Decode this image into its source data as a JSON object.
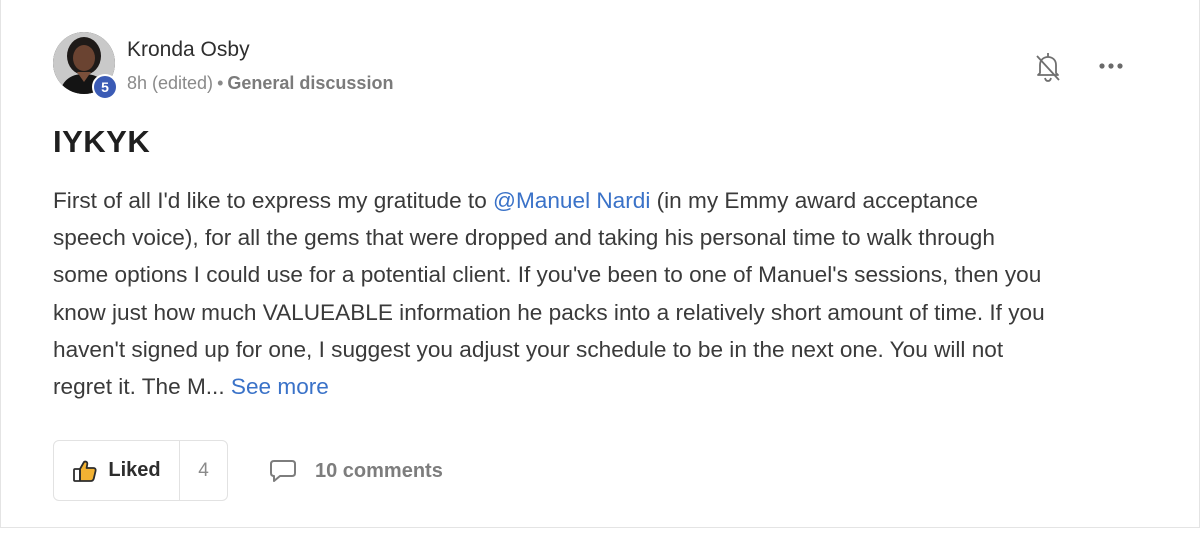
{
  "post": {
    "author": {
      "name": "Kronda Osby",
      "level": "5"
    },
    "meta": {
      "time": "8h (edited)",
      "separator": "•",
      "category": "General discussion"
    },
    "title": "IYKYK",
    "body": {
      "line1_before": "First of all I'd like to express my gratitude to ",
      "mention": "@Manuel Nardi",
      "line1_after": " (in my Emmy award acceptance",
      "line2": "speech voice), for all the gems that were dropped and taking his personal time to walk through",
      "line3": "some options I could use for a potential client. If you've been to one of Manuel's sessions, then you",
      "line4": "know just how much VALUEABLE information he packs into a relatively short amount of time. If you",
      "line5": "haven't signed up for one, I suggest you adjust your schedule to be in the next one. You will not",
      "line6": "regret it. The M... ",
      "see_more": "See more"
    },
    "actions": {
      "like_label": "Liked",
      "like_count": "4",
      "comments_label": "10 comments"
    },
    "icons": {
      "bell": "bell-off-icon",
      "more": "more-horizontal-icon",
      "like": "thumbs-up-icon",
      "comment": "comment-icon"
    },
    "colors": {
      "link": "#3a72c8",
      "level_badge": "#3b5bb5"
    }
  }
}
